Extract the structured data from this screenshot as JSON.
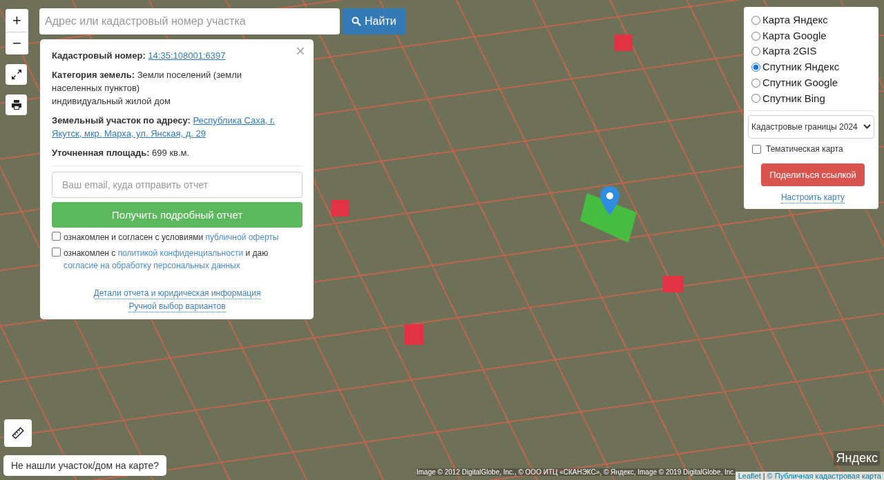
{
  "zoom_controls": [
    "+",
    "−"
  ],
  "search": {
    "placeholder": "Адрес или кадастровый номер участка",
    "button": "Найти"
  },
  "info_panel": {
    "close": "×",
    "fields": [
      {
        "label": "Кадастровый номер:",
        "kind": "link",
        "lines": [
          "14:35:108001:6397"
        ]
      },
      {
        "label": "Категория земель:",
        "kind": "text",
        "lines": [
          "Земли поселений (земли населенных пунктов)",
          "индивидуальный жилой дом"
        ]
      },
      {
        "label": "Земельный участок по адресу:",
        "kind": "link",
        "lines": [
          "Республика Саха, г.",
          "Якутск, мкр. Марха, ул. Янская, д. 29"
        ]
      },
      {
        "label": "Уточненная площадь:",
        "kind": "text",
        "lines": [
          "699 кв.м."
        ]
      }
    ],
    "email": {
      "placeholder": "Ваш email, куда отправить отчет"
    },
    "submit": "Получить подробный отчет",
    "consents": [
      {
        "checked": false,
        "parts": [
          {
            "text": "ознакомлен и согласен с условиями ",
            "link": false
          },
          {
            "text": "публичной оферты",
            "link": true
          }
        ]
      },
      {
        "checked": false,
        "parts": [
          {
            "text": "ознакомлен с ",
            "link": false
          },
          {
            "text": "политикой конфиденциальности",
            "link": true
          },
          {
            "text": " и даю ",
            "link": false
          },
          {
            "text": "согласие на обработку персональных данных",
            "link": true
          }
        ]
      }
    ],
    "links": [
      "Детали отчета и юридическая информация",
      "Ручной выбор вариантов"
    ]
  },
  "layers": [
    {
      "label": "Карта Яндекс",
      "selected": false
    },
    {
      "label": "Карта Google",
      "selected": false
    },
    {
      "label": "Карта 2GIS",
      "selected": false
    },
    {
      "label": "Спутник Яндекс",
      "selected": true
    },
    {
      "label": "Спутник Google",
      "selected": false
    },
    {
      "label": "Спутник Bing",
      "selected": false
    }
  ],
  "overlay_select": "Кадастровые границы 2024",
  "thematic": {
    "label": "Тематическая карта",
    "checked": false
  },
  "share_button": "Поделиться ссылкой",
  "configure_link": "Настроить карту",
  "not_found_button": "Не нашли участок/дом на карте?",
  "map_logo": "Яндекс",
  "attribution": "Image © 2012 DigitalGlobe, Inc., © ООО ИТЦ «СКАНЭКС», © Яндекс, Image © 2019 DigitalGlobe, Inc.",
  "leaflet_link": "Leaflet",
  "separator": "|",
  "cadastral_link": "© Публичная кадастровая карта"
}
